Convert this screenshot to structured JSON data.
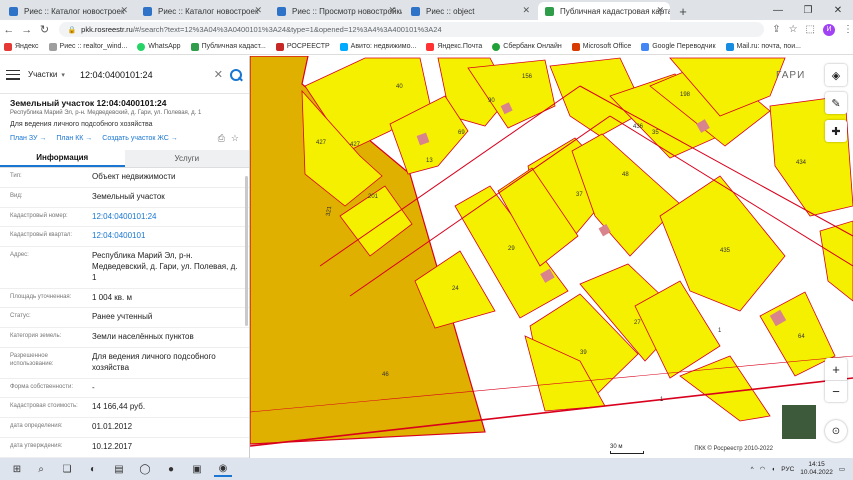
{
  "browser": {
    "tabs": [
      {
        "label": "Риес :: Каталог новостроек",
        "active": false
      },
      {
        "label": "Риес :: Каталог новостроек",
        "active": false
      },
      {
        "label": "Риес :: Просмотр новостройки",
        "active": false
      },
      {
        "label": "Риес :: object",
        "active": false
      },
      {
        "label": "Публичная кадастровая карта",
        "active": true
      }
    ],
    "url_host": "pkk.rosreestr.ru",
    "url_rest": "/#/search?text=12%3A04%3A0400101%3A24&type=1&opened=12%3A4%3A400101%3A24",
    "profile_initial": "И",
    "bookmarks": [
      "Яндекс",
      "Риес :: realtor_wind...",
      "WhatsApp",
      "Публичная кадаст...",
      "РОСРЕЕСТР",
      "Авито: недвижимо...",
      "Яндекс.Почта",
      "Сбербанк Онлайн",
      "Microsoft Office",
      "Google Переводчик",
      "Mail.ru: почта, пои..."
    ]
  },
  "search": {
    "layer": "Участки",
    "query": "12:04:0400101:24"
  },
  "object": {
    "title": "Земельный участок 12:04:0400101:24",
    "address_short": "Республика Марий Эл, р-н. Медведевский, д. Гари, ул. Полевая, д. 1",
    "purpose": "Для ведения личного подсобного хозяйства",
    "links": [
      "План ЗУ →",
      "План КК →",
      "Создать участок ЖС →"
    ]
  },
  "panel_tabs": [
    "Информация",
    "Услуги"
  ],
  "properties": [
    {
      "label": "Тип:",
      "value": "Объект недвижимости",
      "link": false
    },
    {
      "label": "Вид:",
      "value": "Земельный участок",
      "link": false
    },
    {
      "label": "Кадастровый номер:",
      "value": "12:04:0400101:24",
      "link": true
    },
    {
      "label": "Кадастровый квартал:",
      "value": "12:04:0400101",
      "link": true
    },
    {
      "label": "Адрес:",
      "value": "Республика Марий Эл, р-н. Медведевский, д. Гари, ул. Полевая, д. 1",
      "link": false
    },
    {
      "label": "Площадь уточненная:",
      "value": "1 004 кв. м",
      "link": false
    },
    {
      "label": "Статус:",
      "value": "Ранее учтенный",
      "link": false
    },
    {
      "label": "Категория земель:",
      "value": "Земли населённых пунктов",
      "link": false
    },
    {
      "label": "Разрешенное использование:",
      "value": "Для ведения личного подсобного хозяйства",
      "link": false
    },
    {
      "label": "Форма собственности:",
      "value": "-",
      "link": false
    },
    {
      "label": "Кадастровая стоимость:",
      "value": "14 166,44 руб.",
      "link": false
    },
    {
      "label": "дата определения:",
      "value": "01.01.2012",
      "link": false
    },
    {
      "label": "дата утверждения:",
      "value": "10.12.2017",
      "link": false
    }
  ],
  "map": {
    "street_label": "ГАРИ",
    "scale_label": "30 м",
    "copyright": "ПКК © Росреестр 2010-2022",
    "parcel_labels": [
      "40",
      "156",
      "90",
      "198",
      "427",
      "427",
      "13",
      "69",
      "436",
      "35",
      "434",
      "201",
      "48",
      "37",
      "321",
      "29",
      "435",
      "24",
      "1",
      "27",
      "39",
      "64",
      "46",
      "1"
    ],
    "colors": {
      "parcel_fill": "#f5f000",
      "parcel_stroke": "#d8001c",
      "selected_fill": "#e0b000",
      "building": "#d9838d"
    }
  },
  "taskbar": {
    "lang": "РУС",
    "time": "14:15",
    "date": "10.04.2022"
  }
}
